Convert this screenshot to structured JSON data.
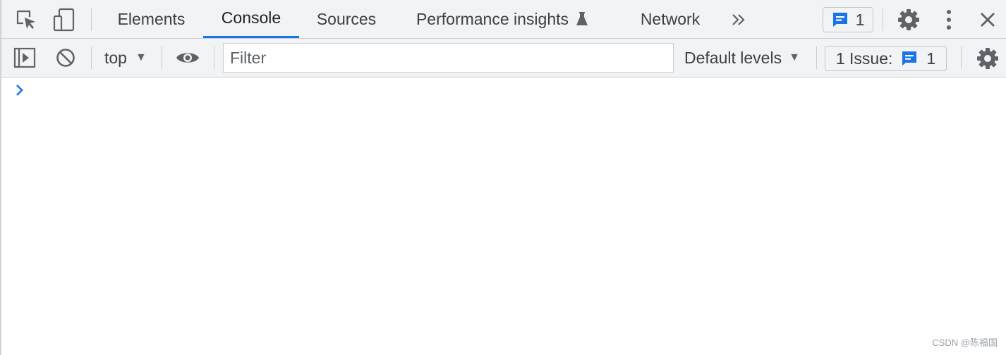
{
  "tabs": [
    {
      "label": "Elements",
      "active": false
    },
    {
      "label": "Console",
      "active": true
    },
    {
      "label": "Sources",
      "active": false
    },
    {
      "label": "Performance insights",
      "active": false
    },
    {
      "label": "Network",
      "active": false
    }
  ],
  "tabbar": {
    "more_tabs_icon": "double-chevron-right-icon",
    "messages_count": "1",
    "settings_icon": "gear-icon",
    "menu_icon": "vertical-dots-icon",
    "close_icon": "close-icon"
  },
  "toolbar": {
    "context": "top",
    "filter_placeholder": "Filter",
    "levels": "Default levels",
    "issues_label": "1 Issue:",
    "issues_count": "1"
  },
  "colors": {
    "accent": "#1a73e8",
    "toolbar_bg": "#f1f3f4",
    "border": "#cacdd1"
  },
  "watermark": "CSDN @陈福国"
}
